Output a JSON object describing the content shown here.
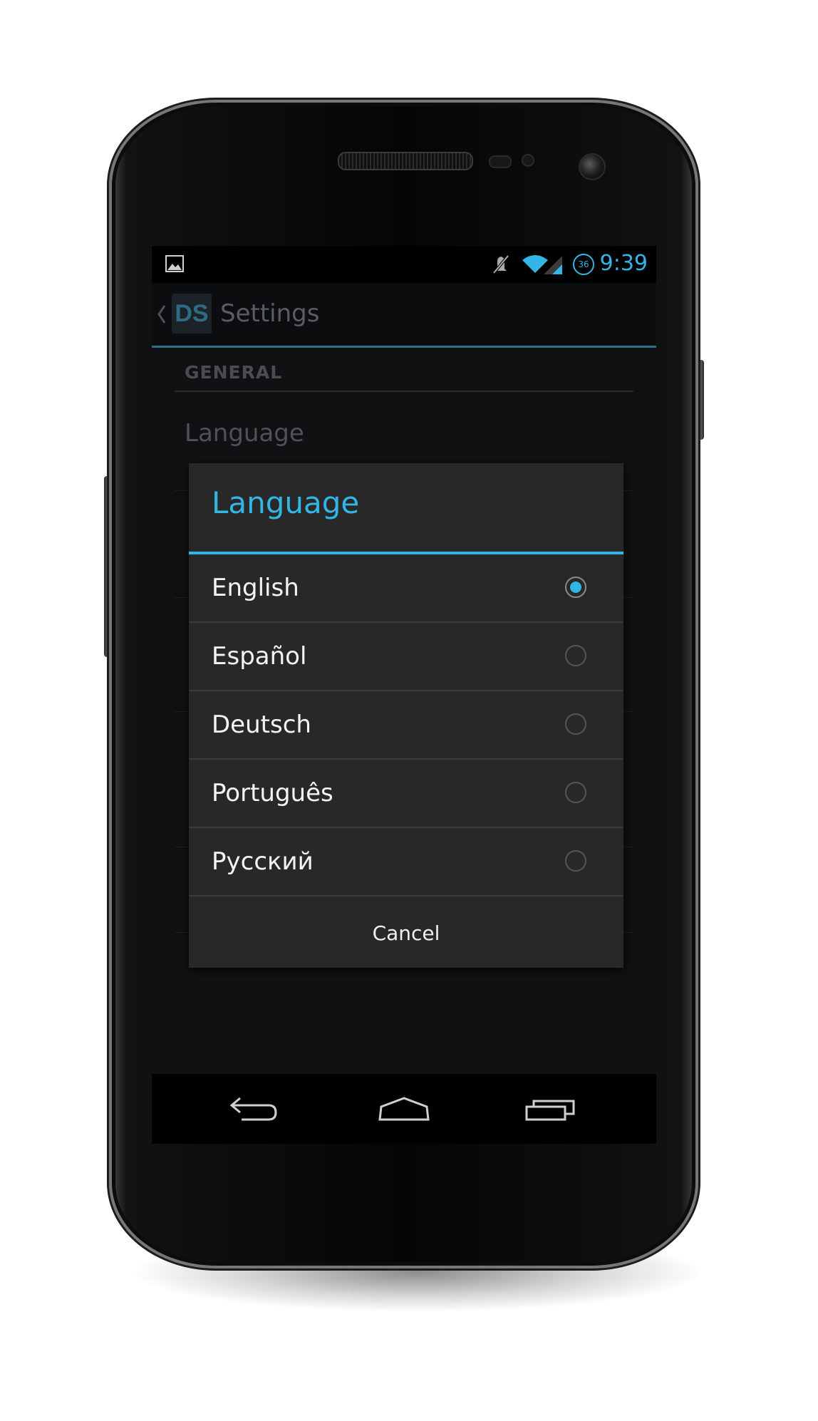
{
  "status_bar": {
    "clock": "9:39",
    "badge": "36",
    "icons": [
      "gallery-icon",
      "mute-icon",
      "wifi-icon",
      "signal-icon"
    ]
  },
  "action_bar": {
    "app_icon_text": "DS",
    "title": "Settings"
  },
  "settings": {
    "section_header": "GENERAL",
    "items": [
      {
        "title": "Language"
      }
    ]
  },
  "dialog": {
    "title": "Language",
    "options": [
      {
        "label": "English",
        "checked": true
      },
      {
        "label": "Español",
        "checked": false
      },
      {
        "label": "Deutsch",
        "checked": false
      },
      {
        "label": "Português",
        "checked": false
      },
      {
        "label": "Русский",
        "checked": false
      }
    ],
    "cancel_label": "Cancel"
  },
  "nav_bar": {
    "buttons": [
      "back-icon",
      "home-icon",
      "recent-apps-icon"
    ]
  },
  "colors": {
    "accent": "#33b5e5",
    "dialog_bg": "#282828",
    "screen_bg": "#101112"
  }
}
